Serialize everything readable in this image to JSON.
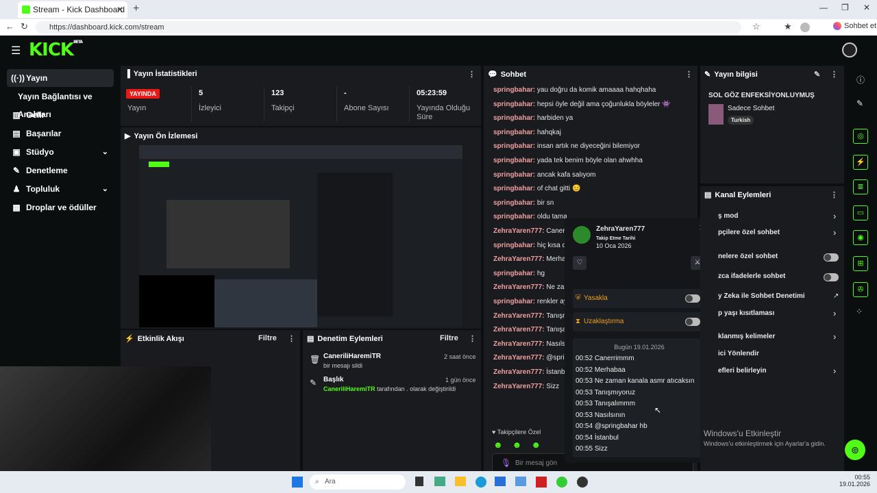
{
  "browser": {
    "tab_title": "Stream - Kick Dashboard",
    "url": "https://dashboard.kick.com/stream",
    "profile_label": "Sohbet et"
  },
  "app": {
    "logo": "KICK",
    "logo_badge": "BETA"
  },
  "sidebar": {
    "items": [
      {
        "label": "Yayın",
        "icon": "stream-icon"
      },
      {
        "label": "Yayın Bağlantısı ve Anahtarı",
        "icon": ""
      },
      {
        "label": "Gelir",
        "icon": "revenue-icon"
      },
      {
        "label": "Başarılar",
        "icon": "achievements-icon"
      },
      {
        "label": "Stüdyo",
        "icon": "studio-icon"
      },
      {
        "label": "Denetleme",
        "icon": "moderation-icon"
      },
      {
        "label": "Topluluk",
        "icon": "community-icon"
      },
      {
        "label": "Droplar ve ödüller",
        "icon": "drops-icon"
      }
    ]
  },
  "stats": {
    "title": "Yayın İstatistikleri",
    "live_badge": "YAYINDA",
    "items": [
      {
        "value": "",
        "label": "Yayın"
      },
      {
        "value": "5",
        "label": "İzleyici"
      },
      {
        "value": "123",
        "label": "Takipçi"
      },
      {
        "value": "-",
        "label": "Abone Sayısı"
      },
      {
        "value": "05:23:59",
        "label": "Yayında Olduğu Süre"
      }
    ]
  },
  "preview": {
    "title": "Yayın Ön İzlemesi"
  },
  "activity": {
    "title": "Etkinlik Akışı",
    "filter": "Filtre"
  },
  "mod_actions": {
    "title": "Denetim Eylemleri",
    "filter": "Filtre",
    "items": [
      {
        "user": "CaneriliHaremiTR",
        "action": "bir mesajı sildi",
        "time": "2 saat önce"
      },
      {
        "user": "Başlık",
        "action_user": "CaneriliHaremiTR",
        "action": "tarafından . olarak değiştirildi",
        "time": "1 gün önce"
      }
    ]
  },
  "chat": {
    "title": "Sohbet",
    "messages": [
      {
        "user": "springbahar",
        "text": "yau doğru da komik amaaaa hahqhaha"
      },
      {
        "user": "springbahar",
        "text": "hepsi öyle değil ama çoğunlukla böyleler 👾"
      },
      {
        "user": "springbahar",
        "text": "harbiden ya"
      },
      {
        "user": "springbahar",
        "text": "hahqkaj"
      },
      {
        "user": "springbahar",
        "text": "insan artık ne diyeceğini bilemiyor"
      },
      {
        "user": "springbahar",
        "text": "yada tek benim böyle olan ahwhha"
      },
      {
        "user": "springbahar",
        "text": "ancak kafa salıyom"
      },
      {
        "user": "springbahar",
        "text": "of chat gitti 😊"
      },
      {
        "user": "springbahar",
        "text": "bir sn"
      },
      {
        "user": "springbahar",
        "text": "oldu tama"
      },
      {
        "user": "ZehraYaren777",
        "text": "Caner"
      },
      {
        "user": "springbahar",
        "text": "hiç kısa d"
      },
      {
        "user": "ZehraYaren777",
        "text": "Merha"
      },
      {
        "user": "springbahar",
        "text": "hg"
      },
      {
        "user": "ZehraYaren777",
        "text": "Ne zar"
      },
      {
        "user": "springbahar",
        "text": "renkler ay"
      },
      {
        "user": "ZehraYaren777",
        "text": "Tanışn"
      },
      {
        "user": "ZehraYaren777",
        "text": "Tanışa"
      },
      {
        "user": "ZehraYaren777",
        "text": "Nasılsı"
      },
      {
        "user": "ZehraYaren777",
        "text": "@sprir"
      },
      {
        "user": "ZehraYaren777",
        "text": "İstanb"
      },
      {
        "user": "ZehraYaren777",
        "text": "Sizz"
      }
    ],
    "followers_mode": "Takipçilere Özel",
    "input_placeholder": "Bir mesaj gön"
  },
  "user_popup": {
    "username": "ZehraYaren777",
    "follow_label": "Takip Etme Tarihi",
    "follow_date": "10 Oca 2026",
    "ban_label": "Yasakla",
    "timeout_label": "Uzaklaştırma",
    "date_header": "Bugün 19.01.2026",
    "log": [
      {
        "time": "00:52",
        "text": "Canerrimmm"
      },
      {
        "time": "00:52",
        "text": "Merhabaa"
      },
      {
        "time": "00:53",
        "text": "Ne zaman kanala asmr atıcaksın"
      },
      {
        "time": "00:53",
        "text": "Tanışmıyoruz"
      },
      {
        "time": "00:53",
        "text": "Tanışalımmm"
      },
      {
        "time": "00:53",
        "text": "Nasılsının"
      },
      {
        "time": "00:54",
        "text": "@springbahar hb"
      },
      {
        "time": "00:54",
        "text": "İstanbul"
      },
      {
        "time": "00:55",
        "text": "Sizz"
      }
    ]
  },
  "stream_info": {
    "title": "Yayın bilgisi",
    "stream_title": "SOL GÖZ ENFEKSİYONLUYMUŞ",
    "category": "Sadece Sohbet",
    "tag": "Turkish"
  },
  "channel_actions": {
    "title": "Kanal Eylemleri",
    "items": [
      {
        "label": "ş mod",
        "control": "chevron"
      },
      {
        "label": "pçilere özel sohbet",
        "control": "chevron"
      },
      {
        "label": "nelere özel sohbet",
        "control": "toggle"
      },
      {
        "label": "zca ifadelerle sohbet",
        "control": "toggle"
      },
      {
        "label": "y Zeka ile Sohbet Denetimi",
        "control": "external"
      },
      {
        "label": "p yaşı kısıtlaması",
        "control": "chevron"
      },
      {
        "label": "klanmış kelimeler",
        "control": "chevron"
      },
      {
        "label": "ici Yönlendir",
        "control": "none"
      },
      {
        "label": "efleri belirleyin",
        "control": "chevron"
      }
    ]
  },
  "windows": {
    "activate_title": "Windows'u Etkinleştir",
    "activate_sub": "Windows'u etkinleştirmek için Ayarlar'a gidin.",
    "search_placeholder": "Ara",
    "clock_time": "00:55",
    "clock_date": "19.01.2026"
  },
  "colors": {
    "accent": "#53fc18",
    "live": "#e91916",
    "panel": "#191b1f"
  }
}
